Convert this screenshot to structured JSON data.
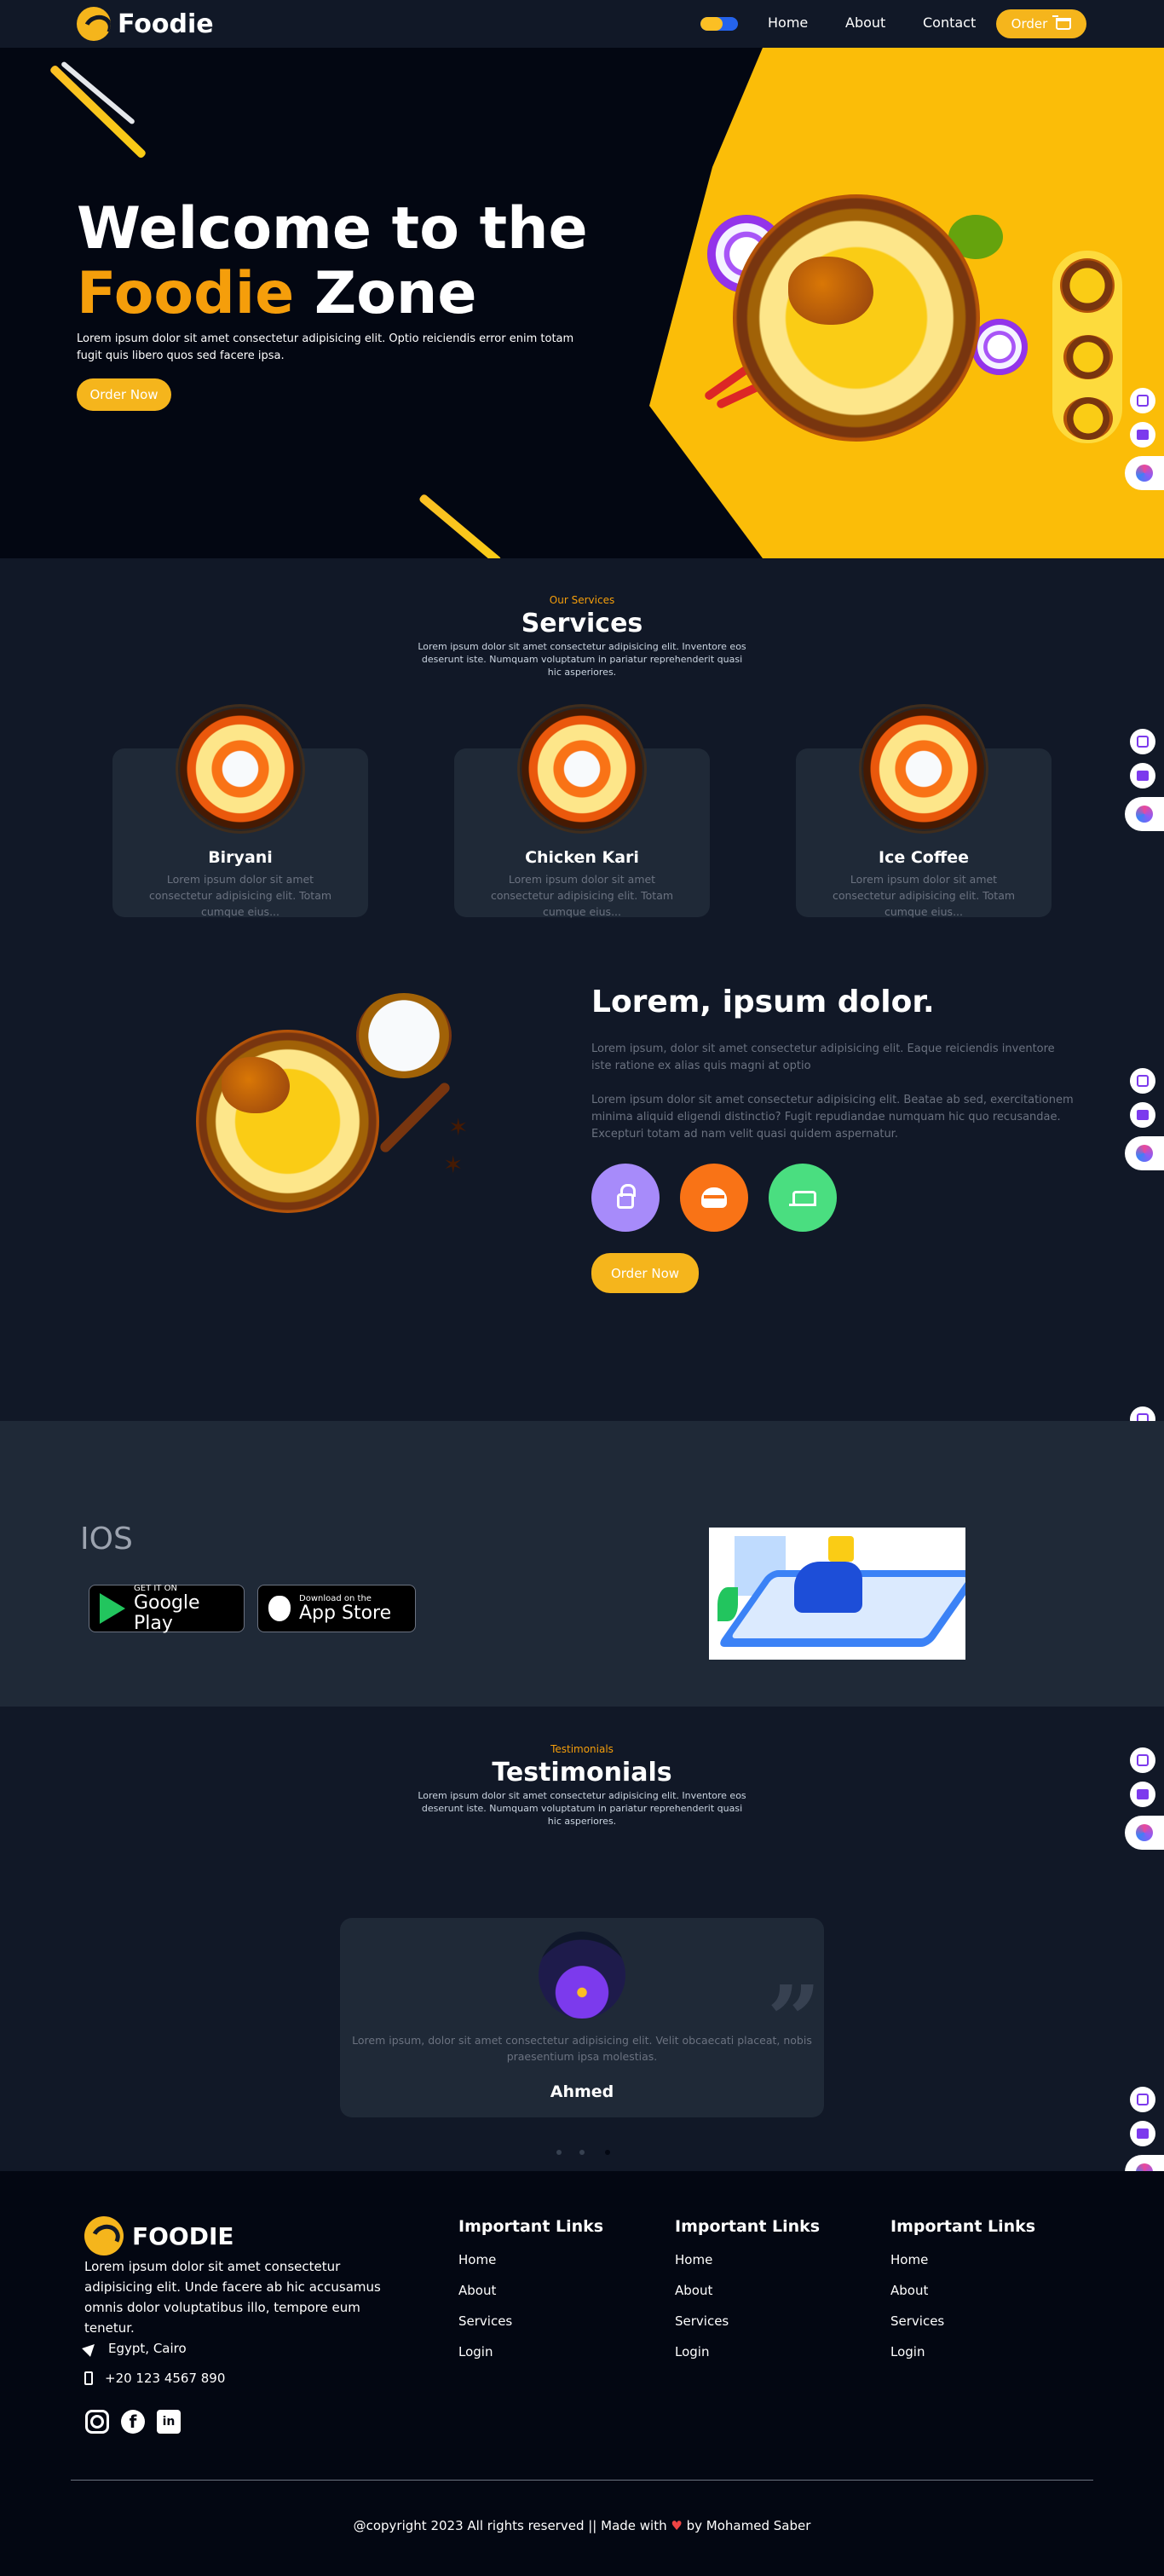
{
  "nav": {
    "brand": "Foodie",
    "links": [
      "Home",
      "About",
      "Contact"
    ],
    "order_label": "Order"
  },
  "hero": {
    "title_line1": "Welcome to the",
    "title_accent": "Foodie",
    "title_rest": " Zone",
    "subtitle": "Lorem ipsum dolor sit amet consectetur adipisicing elit. Optio reiciendis error enim totam fugit quis libero quos sed facere ipsa.",
    "cta": "Order Now"
  },
  "services": {
    "eyebrow": "Our Services",
    "title": "Services",
    "description": "Lorem ipsum dolor sit amet consectetur adipisicing elit. Inventore eos deserunt iste. Numquam voluptatum in pariatur reprehenderit quasi hic asperiores.",
    "cards": [
      {
        "title": "Biryani",
        "desc": "Lorem ipsum dolor sit amet consectetur adipisicing elit. Totam cumque eius..."
      },
      {
        "title": "Chicken Kari",
        "desc": "Lorem ipsum dolor sit amet consectetur adipisicing elit. Totam cumque eius..."
      },
      {
        "title": "Ice Coffee",
        "desc": "Lorem ipsum dolor sit amet consectetur adipisicing elit. Totam cumque eius..."
      }
    ]
  },
  "about": {
    "title": "Lorem, ipsum dolor.",
    "p1": "Lorem ipsum, dolor sit amet consectetur adipisicing elit. Eaque reiciendis inventore iste ratione ex alias quis magni at optio",
    "p2": "Lorem ipsum dolor sit amet consectetur adipisicing elit. Beatae ab sed, exercitationem minima aliquid eligendi distinctio? Fugit repudiandae numquam hic quo recusandae. Excepturi totam ad nam velit quasi quidem aspernatur.",
    "cta": "Order Now",
    "icon_colors": [
      "#a78bfa",
      "#f97316",
      "#4ade80"
    ]
  },
  "app": {
    "heading": "IOS",
    "google_small": "GET IT ON",
    "google_big": "Google Play",
    "apple_small": "Download on the",
    "apple_big": "App Store"
  },
  "testimonials": {
    "eyebrow": "Testimonials",
    "title": "Testimonials",
    "description": "Lorem ipsum dolor sit amet consectetur adipisicing elit. Inventore eos deserunt iste. Numquam voluptatum in pariatur reprehenderit quasi hic asperiores.",
    "quote": "Lorem ipsum, dolor sit amet consectetur adipisicing elit. Velit obcaecati placeat, nobis praesentium ipsa molestias.",
    "name": "Ahmed"
  },
  "footer": {
    "brand": "FOODIE",
    "about": "Lorem ipsum dolor sit amet consectetur adipisicing elit. Unde facere ab hic accusamus omnis dolor voluptatibus illo, tempore eum tenetur.",
    "address": "Egypt, Cairo",
    "phone": "+20 123 4567 890",
    "columns": [
      {
        "title": "Important Links",
        "links": [
          "Home",
          "About",
          "Services",
          "Login"
        ]
      },
      {
        "title": "Important Links",
        "links": [
          "Home",
          "About",
          "Services",
          "Login"
        ]
      },
      {
        "title": "Important Links",
        "links": [
          "Home",
          "About",
          "Services",
          "Login"
        ]
      }
    ],
    "copyright_pre": "@copyright 2023 All rights reserved || Made with",
    "heart": "♥",
    "copyright_post": "by Mohamed Saber"
  },
  "colors": {
    "accent": "#f5b51c",
    "background": "#111827",
    "card": "#1f2937"
  }
}
